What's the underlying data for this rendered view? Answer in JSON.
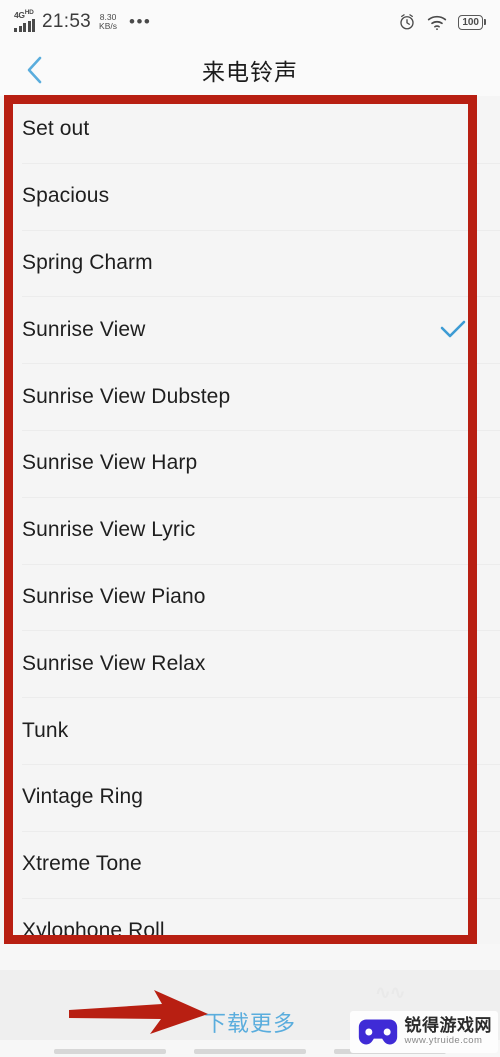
{
  "status_bar": {
    "network_type": "4G",
    "network_suffix": "HD",
    "time": "21:53",
    "speed_value": "8.30",
    "speed_unit": "KB/s",
    "overflow_dots": "•••",
    "alarm_icon": "alarm-clock-icon",
    "wifi_icon": "wifi-icon",
    "battery_level": "100"
  },
  "title_bar": {
    "back_icon": "back-chevron-icon",
    "title": "来电铃声"
  },
  "ringtones": {
    "selected": "Sunrise View",
    "items": [
      {
        "label": "Set out",
        "selected": false
      },
      {
        "label": "Spacious",
        "selected": false
      },
      {
        "label": "Spring Charm",
        "selected": false
      },
      {
        "label": "Sunrise View",
        "selected": true
      },
      {
        "label": "Sunrise View Dubstep",
        "selected": false
      },
      {
        "label": "Sunrise View Harp",
        "selected": false
      },
      {
        "label": "Sunrise View Lyric",
        "selected": false
      },
      {
        "label": "Sunrise View Piano",
        "selected": false
      },
      {
        "label": "Sunrise View Relax",
        "selected": false
      },
      {
        "label": "Tunk",
        "selected": false
      },
      {
        "label": "Vintage Ring",
        "selected": false
      },
      {
        "label": "Xtreme Tone",
        "selected": false
      },
      {
        "label": "Xylophone Roll",
        "selected": false
      }
    ]
  },
  "footer": {
    "download_more": "下载更多"
  },
  "watermark": {
    "brand": "锐得游戏网",
    "url": "www.ytruide.com",
    "icon": "gamepad-icon"
  },
  "annotations": {
    "box_color": "#b81f12",
    "arrow_color": "#b81f12",
    "accent_blue": "#5aaddd",
    "check_color": "#3d9bd4"
  }
}
